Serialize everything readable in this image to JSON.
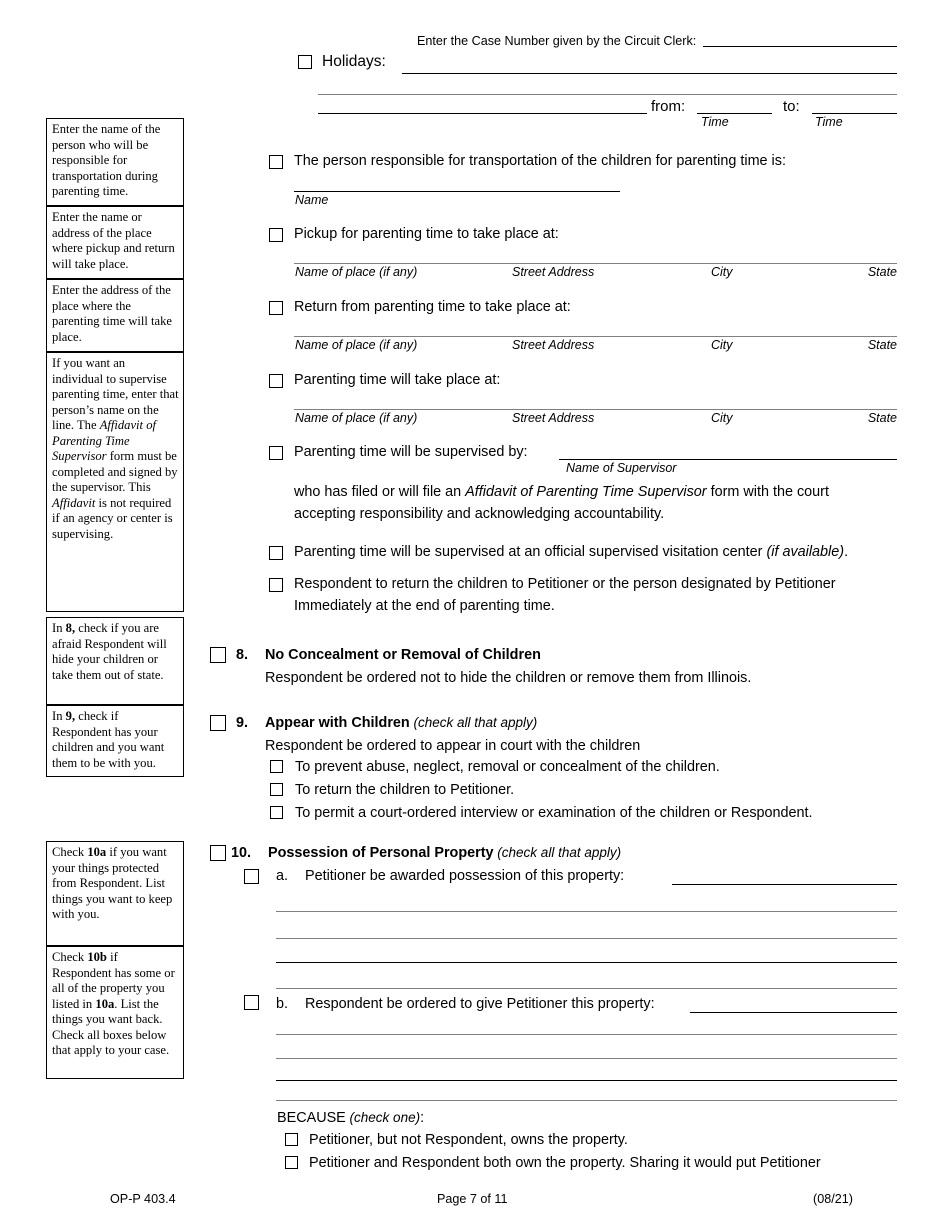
{
  "header": {
    "case_number_label": "Enter the Case Number given by the Circuit Clerk:"
  },
  "holidays": {
    "label": "Holidays:",
    "from_label": "from:",
    "to_label": "to:",
    "time_caption_1": "Time",
    "time_caption_2": "Time"
  },
  "sidebar": {
    "notes": [
      {
        "id": "transportation-note",
        "html": "Enter the name of the person who will be responsible for transportation during parenting time."
      },
      {
        "id": "pickup-return-note",
        "html": "Enter the name or address of the place where pickup and return will take place."
      },
      {
        "id": "parenting-place-note",
        "html": "Enter the address of the place where the parenting time will take place."
      },
      {
        "id": "supervisor-note",
        "html": "If you want an individual to supervise parenting time, enter that person&rsquo;s name on the line. The <i>Affidavit of Parenting Time Supervisor</i> form must be completed and signed by the supervisor. This <i>Affidavit</i> is not required if an agency or center is supervising."
      },
      {
        "id": "item8-note",
        "html": "In <b>8,</b> check if you are afraid Respondent will hide your children or take them out of state."
      },
      {
        "id": "item9-note",
        "html": "In <b>9,</b> check if Respondent has your children and you want them to be with you."
      },
      {
        "id": "item10a-note",
        "html": "Check <b>10a</b> if you want your things protected from Respondent. List things you want to keep with you."
      },
      {
        "id": "item10b-note",
        "html": "Check <b>10b</b> if Respondent has some or all of the property you listed in <b>10a</b>. List the things you want back. Check all boxes below that apply to your case."
      }
    ]
  },
  "main": {
    "transportation": {
      "text": "The person responsible for transportation of the children for parenting time is:",
      "caption": "Name"
    },
    "pickup": {
      "text": "Pickup for parenting time to take place at:"
    },
    "return": {
      "text": "Return from parenting time to take place at:"
    },
    "place": {
      "text": "Parenting time will take place at:"
    },
    "address_captions": {
      "name_of_place": "Name of place (if any)",
      "street_address": "Street Address",
      "city": "City",
      "state": "State"
    },
    "supervised_by": {
      "text": "Parenting time will be supervised by:",
      "caption": "Name of Supervisor",
      "continuation_line_1": "who has filed or will file an ",
      "continuation_italic": "Affidavit of Parenting Time Supervisor",
      "continuation_line_1_tail": " form with the court",
      "continuation_line_2": "accepting responsibility and acknowledging accountability."
    },
    "visitation_center": {
      "text": "Parenting time will be supervised at an official supervised visitation center ",
      "italic_tail": "(if available)",
      "period": "."
    },
    "return_children": {
      "line1": "Respondent to return the children to Petitioner or the person designated by Petitioner",
      "line2": "Immediately at the end of parenting time."
    }
  },
  "item8": {
    "number": "8.",
    "title": "No Concealment or Removal of Children",
    "body": "Respondent be ordered not to hide the children or remove them from Illinois."
  },
  "item9": {
    "number": "9.",
    "title": "Appear with Children",
    "title_note": "(check all that apply)",
    "body": "Respondent be ordered to appear in court with the children",
    "options": [
      "To prevent abuse, neglect, removal or concealment of the children.",
      "To return the children to Petitioner.",
      "To permit a court-ordered interview or examination of the children or Respondent."
    ]
  },
  "item10": {
    "number": "10.",
    "title": "Possession of Personal Property",
    "title_note": "(check all that apply)",
    "a": {
      "letter": "a.",
      "text": "Petitioner be awarded possession of this property:"
    },
    "b": {
      "letter": "b.",
      "text": "Respondent be ordered to give Petitioner this property:"
    },
    "because": {
      "label": "BECAUSE",
      "note": "(check one)",
      "colon": ":",
      "options": [
        "Petitioner, but not Respondent, owns the property.",
        "Petitioner and Respondent both own the property. Sharing it would put Petitioner"
      ]
    }
  },
  "footer": {
    "form_code": "OP-P 403.4",
    "page": "Page 7 of 11",
    "revision": "(08/21)"
  }
}
